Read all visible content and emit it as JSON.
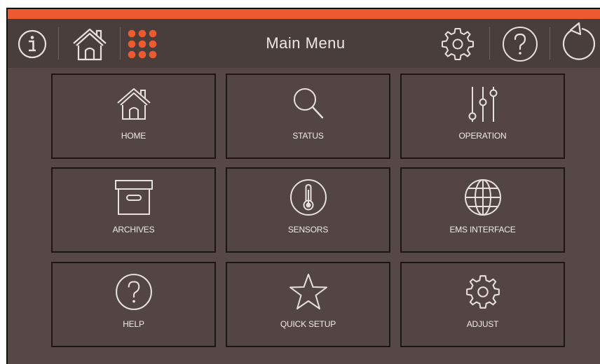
{
  "header": {
    "title": "Main Menu",
    "accent_color": "#ee5a2f",
    "icons": [
      "info-icon",
      "home-icon",
      "grid-menu-icon",
      "gear-icon",
      "help-icon",
      "back-icon"
    ]
  },
  "tiles": [
    {
      "label": "HOME",
      "icon": "home-icon"
    },
    {
      "label": "STATUS",
      "icon": "search-icon"
    },
    {
      "label": "OPERATION",
      "icon": "sliders-icon"
    },
    {
      "label": "ARCHIVES",
      "icon": "archive-box-icon"
    },
    {
      "label": "SENSORS",
      "icon": "thermometer-icon"
    },
    {
      "label": "EMS INTERFACE",
      "icon": "globe-icon"
    },
    {
      "label": "HELP",
      "icon": "help-icon"
    },
    {
      "label": "QUICK SETUP",
      "icon": "star-icon"
    },
    {
      "label": "ADJUST",
      "icon": "gear-icon"
    }
  ]
}
